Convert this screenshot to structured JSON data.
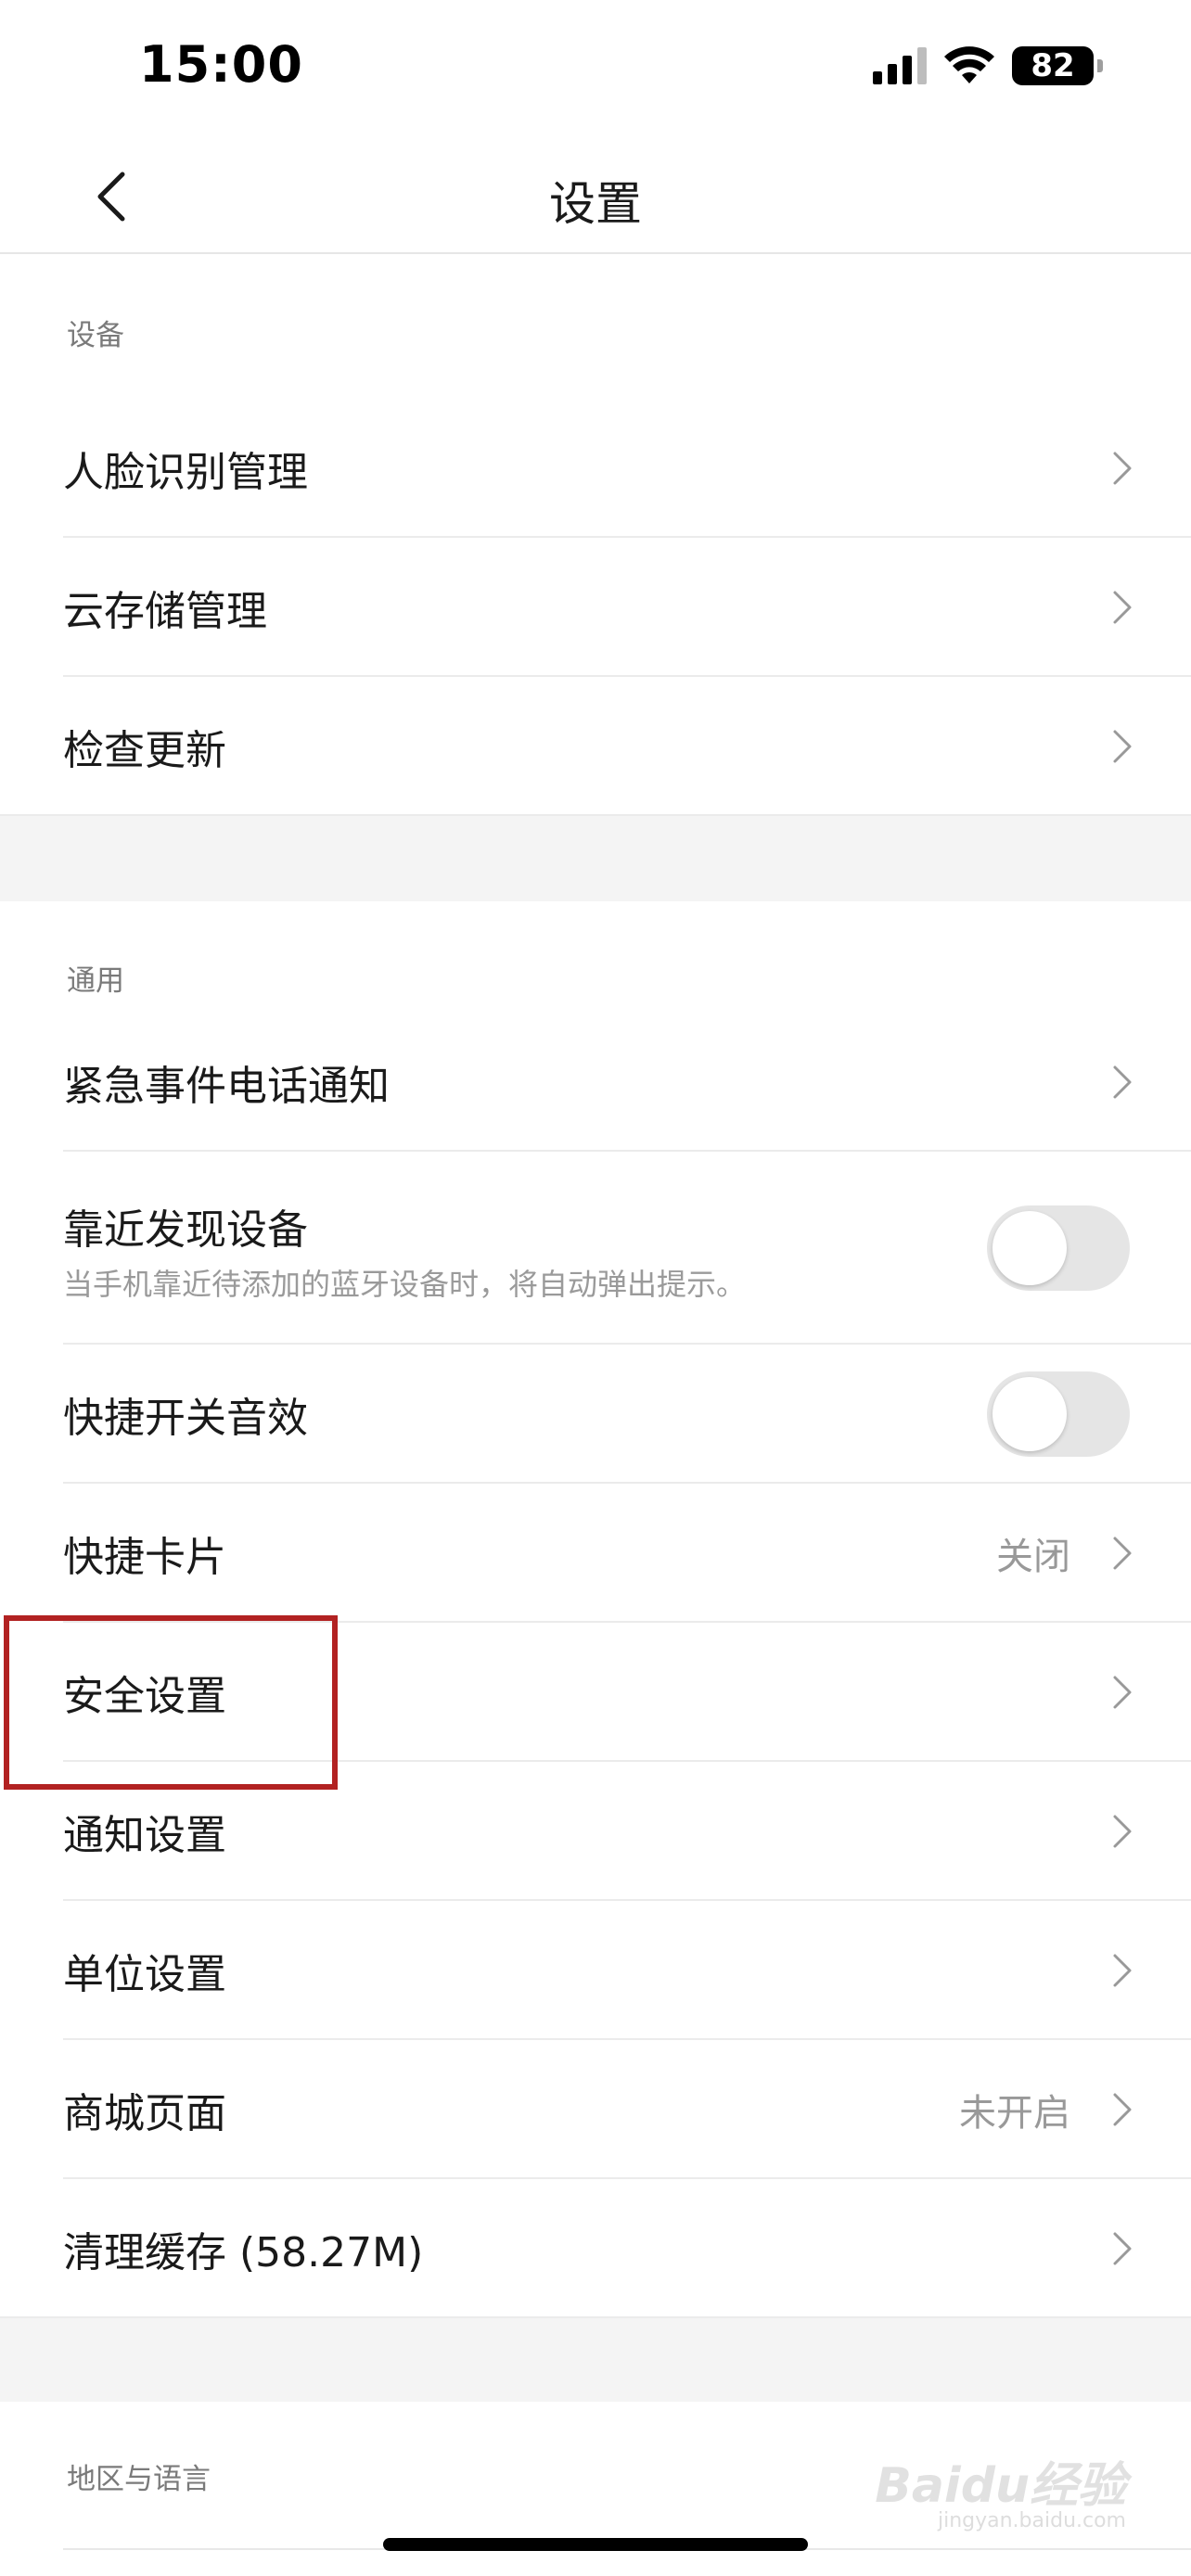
{
  "status_bar": {
    "time": "15:00",
    "battery": "82"
  },
  "nav": {
    "title": "设置"
  },
  "sections": {
    "device": {
      "label": "设备",
      "items": [
        {
          "title": "人脸识别管理"
        },
        {
          "title": "云存储管理"
        },
        {
          "title": "检查更新"
        }
      ]
    },
    "general": {
      "label": "通用",
      "items": [
        {
          "title": "紧急事件电话通知"
        },
        {
          "title": "靠近发现设备",
          "subtitle": "当手机靠近待添加的蓝牙设备时，将自动弹出提示。",
          "toggle": "off"
        },
        {
          "title": "快捷开关音效",
          "toggle": "off"
        },
        {
          "title": "快捷卡片",
          "value": "关闭"
        },
        {
          "title": "安全设置"
        },
        {
          "title": "通知设置"
        },
        {
          "title": "单位设置"
        },
        {
          "title": "商城页面",
          "value": "未开启"
        },
        {
          "title": "清理缓存 (58.27M)"
        }
      ]
    },
    "region": {
      "label": "地区与语言"
    }
  },
  "watermark": {
    "main": "Baidu经验",
    "sub": "jingyan.baidu.com"
  },
  "colors": {
    "highlight": "#b22222",
    "background_band": "#f4f4f4",
    "toggle_off": "#e5e5e5"
  },
  "icons": [
    "signal-icon",
    "wifi-icon",
    "battery-icon",
    "back-chevron-icon",
    "chevron-right-icon"
  ]
}
